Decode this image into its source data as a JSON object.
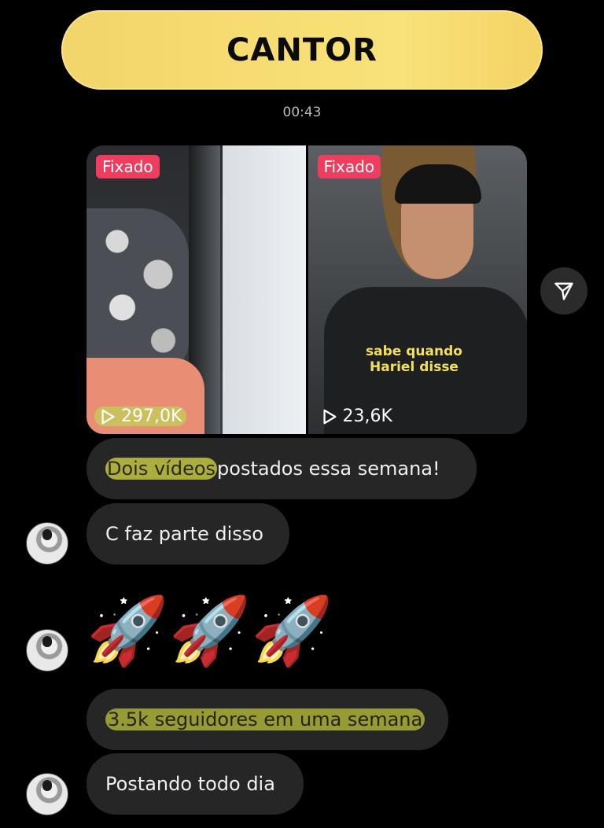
{
  "header": {
    "title": "CANTOR"
  },
  "timestamp": "00:43",
  "shared_media": {
    "items": [
      {
        "badge": "Fixado",
        "views": "297,0K"
      },
      {
        "badge": "Fixado",
        "views": "23,6K",
        "caption_line1": "sabe quando",
        "caption_line2": "Hariel disse"
      }
    ],
    "share_icon": "send-icon"
  },
  "messages": [
    {
      "highlight": "Dois vídeos",
      "rest": " postados essa semana!"
    },
    {
      "text": "C faz parte disso"
    },
    {
      "text": "🚀🚀🚀"
    },
    {
      "text": "3.5k seguidores em uma semana"
    },
    {
      "text": "Postando todo dia"
    }
  ],
  "colors": {
    "banner": "#f6dc72",
    "pin_badge": "#ee3d5e",
    "highlight": "#babd42",
    "bubble": "#262626"
  }
}
